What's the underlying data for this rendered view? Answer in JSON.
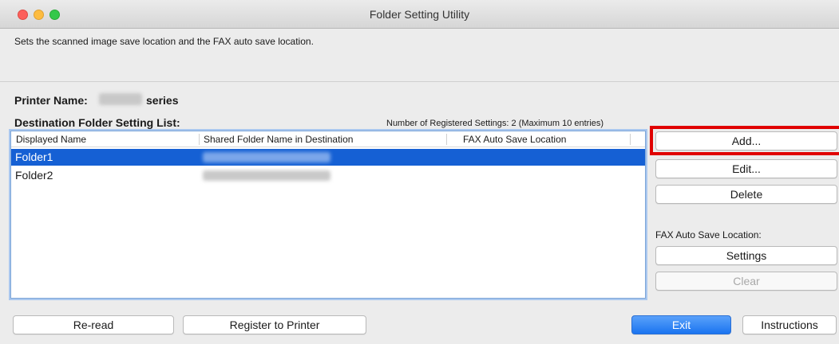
{
  "window": {
    "title": "Folder Setting Utility",
    "description": "Sets the scanned image save location and the FAX auto save location."
  },
  "printer": {
    "label": "Printer Name:",
    "suffix": "series"
  },
  "list": {
    "label": "Destination Folder Setting List:",
    "count_text": "Number of Registered Settings: 2 (Maximum 10 entries)",
    "columns": [
      "Displayed Name",
      "Shared Folder Name in Destination",
      "FAX Auto Save Location"
    ],
    "rows": [
      {
        "name": "Folder1",
        "selected": true
      },
      {
        "name": "Folder2",
        "selected": false
      }
    ]
  },
  "side_buttons": {
    "add": "Add...",
    "edit": "Edit...",
    "delete": "Delete",
    "fax_label": "FAX Auto Save Location:",
    "settings": "Settings",
    "clear": "Clear"
  },
  "bottom_buttons": {
    "reread": "Re-read",
    "register": "Register to Printer",
    "exit": "Exit",
    "instructions": "Instructions"
  },
  "colors": {
    "selection": "#1560d4",
    "highlight": "#e00000",
    "primary_button": "#1a74f0"
  }
}
